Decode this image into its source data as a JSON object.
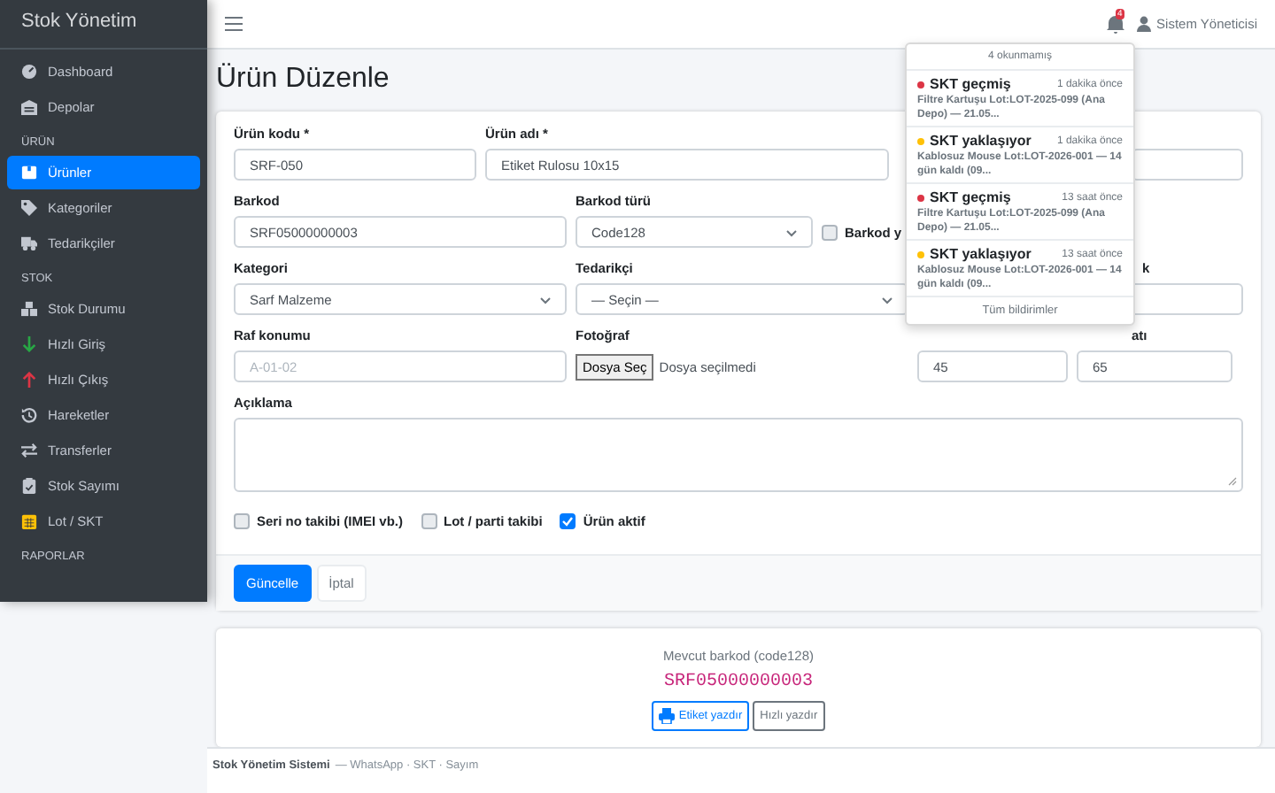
{
  "sidebar": {
    "brand": "Stok Yönetim",
    "sections": [
      {
        "items": [
          {
            "label": "Dashboard",
            "selected": false
          },
          {
            "label": "Depolar",
            "selected": false
          }
        ]
      },
      {
        "heading": "ÜRÜN",
        "items": [
          {
            "label": "Ürünler",
            "selected": true
          },
          {
            "label": "Kategoriler",
            "selected": false
          },
          {
            "label": "Tedarikçiler",
            "selected": false
          }
        ]
      },
      {
        "heading": "STOK",
        "items": [
          {
            "label": "Stok Durumu",
            "selected": false
          },
          {
            "label": "Hızlı Giriş",
            "selected": false
          },
          {
            "label": "Hızlı Çıkış",
            "selected": false
          },
          {
            "label": "Hareketler",
            "selected": false
          },
          {
            "label": "Transferler",
            "selected": false
          },
          {
            "label": "Stok Sayımı",
            "selected": false
          },
          {
            "label": "Lot / SKT",
            "selected": false
          }
        ]
      },
      {
        "heading": "RAPORLAR"
      }
    ]
  },
  "topbar": {
    "notification_count": "4",
    "user": "Sistem Yöneticisi"
  },
  "page_title": "Ürün Düzenle",
  "form": {
    "rows": [
      [
        {
          "kind": "input",
          "label": "Ürün kodu *",
          "value": "SRF-050"
        },
        {
          "kind": "input",
          "label": "Ürün adı *",
          "value": "Etiket Rulosu 10x15"
        },
        {
          "kind": "input"
        }
      ],
      [
        {
          "kind": "input",
          "label": "Barkod",
          "value": "SRF05000000003"
        },
        {
          "kind": "select",
          "label": "Barkod türü",
          "value": "Code128"
        },
        {
          "kind": "checkbox",
          "label": "Barkod y",
          "checked": false
        }
      ],
      [
        {
          "kind": "select",
          "label": "Kategori",
          "value": "Sarf Malzeme"
        },
        {
          "kind": "select",
          "label": "Tedarikçi",
          "value": "— Seçin —"
        },
        {
          "kind": "input",
          "label": "k"
        }
      ],
      [
        {
          "kind": "input",
          "label": "Raf konumu",
          "placeholder": "A-01-02"
        },
        {
          "kind": "file",
          "label": "Fotoğraf",
          "button": "Dosya Seç",
          "value": "Dosya seçilmedi"
        },
        {
          "kind": "input",
          "value": "45"
        },
        {
          "kind": "input",
          "label": "atı",
          "value": "65"
        }
      ],
      [
        {
          "kind": "textarea",
          "label": "Açıklama"
        }
      ]
    ],
    "checks": [
      {
        "label": "Seri no takibi (IMEI vb.)",
        "checked": false
      },
      {
        "label": "Lot / parti takibi",
        "checked": false
      },
      {
        "label": "Ürün aktif",
        "checked": true
      }
    ],
    "buttons": [
      {
        "label": "Güncelle",
        "kind": "primary"
      },
      {
        "label": "İptal",
        "kind": "link"
      }
    ]
  },
  "barcode_card": {
    "caption": "Mevcut barkod (code128)",
    "code": "SRF05000000003",
    "buttons": [
      {
        "label": "Etiket yazdır",
        "kind": "print"
      },
      {
        "label": "Hızlı yazdır",
        "kind": "plain"
      }
    ]
  },
  "footer": {
    "brand": "Stok Yönetim Sistemi",
    "text": "— WhatsApp · SKT · Sayım"
  },
  "notifications": {
    "header": "4 okunmamış",
    "items": [
      {
        "title": "SKT geçmiş",
        "time": "1 dakika önce",
        "text": "Filtre Kartuşu Lot:LOT-2025-099 (Ana Depo) — 21.05...",
        "color": "#dc3545"
      },
      {
        "title": "SKT yaklaşıyor",
        "time": "1 dakika önce",
        "text": "Kablosuz Mouse Lot:LOT-2026-001 — 14 gün kaldı (09...",
        "color": "#ffc107"
      },
      {
        "title": "SKT geçmiş",
        "time": "13 saat önce",
        "text": "Filtre Kartuşu Lot:LOT-2025-099 (Ana Depo) — 21.05...",
        "color": "#dc3545"
      },
      {
        "title": "SKT yaklaşıyor",
        "time": "13 saat önce",
        "text": "Kablosuz Mouse Lot:LOT-2026-001 — 14 gün kaldı (09...",
        "color": "#ffc107"
      }
    ],
    "footer": "Tüm bildirimler"
  }
}
